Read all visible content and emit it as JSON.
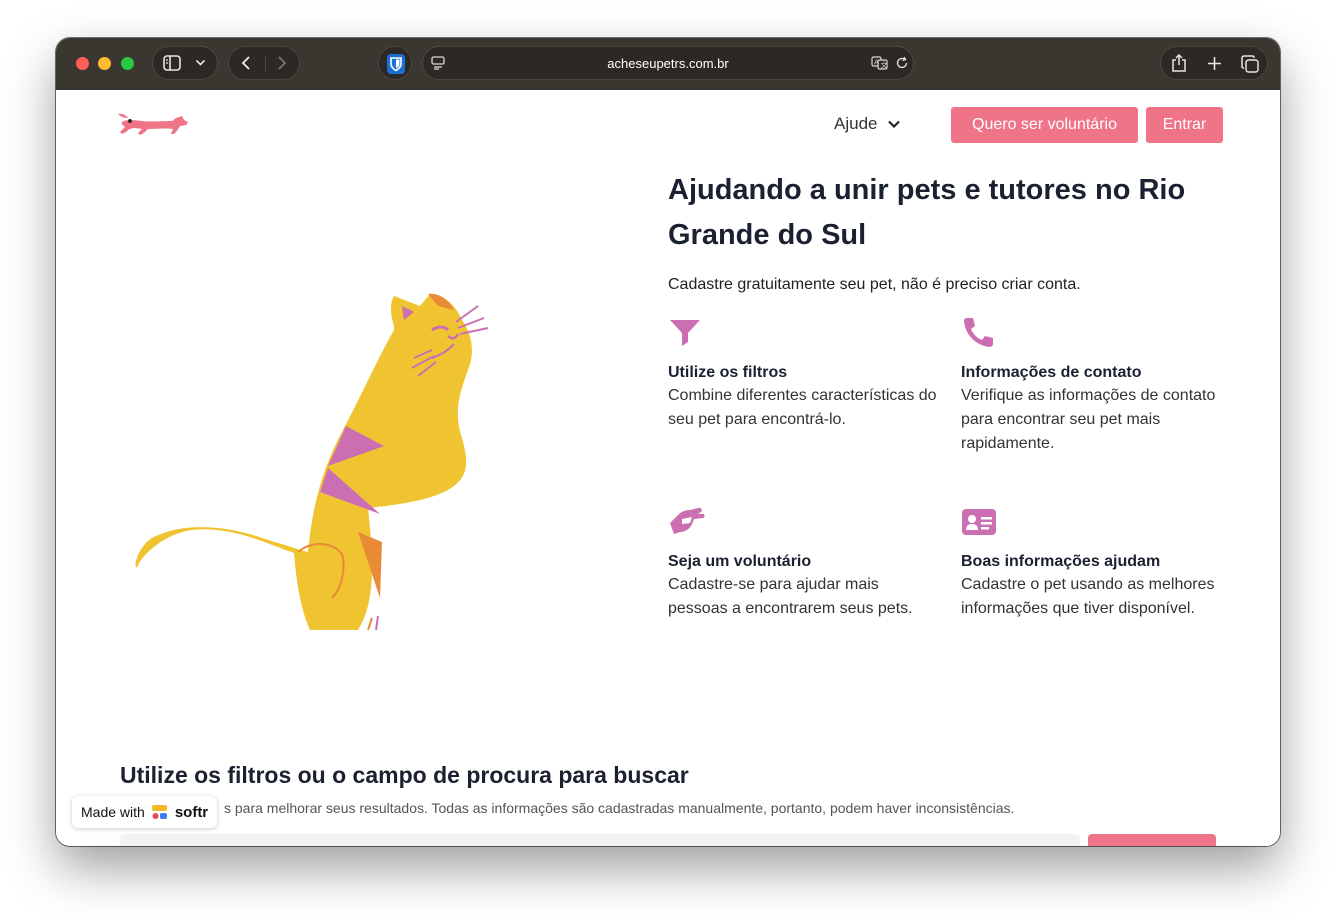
{
  "browser": {
    "url": "acheseupetrs.com.br"
  },
  "nav": {
    "help_label": "Ajude",
    "volunteer_label": "Quero ser voluntário",
    "login_label": "Entrar"
  },
  "hero": {
    "title": "Ajudando a unir pets e tutores no Rio Grande do Sul",
    "subtitle": "Cadastre gratuitamente seu pet, não é preciso criar conta."
  },
  "features": [
    {
      "icon": "filter-icon",
      "title": "Utilize os filtros",
      "text": "Combine diferentes características do seu pet para encontrá-lo."
    },
    {
      "icon": "phone-icon",
      "title": "Informações de contato",
      "text": "Verifique as informações de contato para encontrar seu pet mais rapidamente."
    },
    {
      "icon": "helping-hand-icon",
      "title": "Seja um voluntário",
      "text": "Cadastre-se para ajudar mais pessoas a encontrarem seus pets."
    },
    {
      "icon": "id-card-icon",
      "title": "Boas informações ajudam",
      "text": "Cadastre o pet usando as melhores informações que tiver disponível."
    }
  ],
  "search": {
    "title": "Utilize os filtros ou o campo de procura para buscar",
    "subtitle_visible": "s para melhorar seus resultados. Todas as informações são cadastradas manualmente, portanto, podem haver inconsistências."
  },
  "badge": {
    "made_with": "Made with",
    "brand": "softr"
  },
  "colors": {
    "accent_pink": "#f07488",
    "icon_magenta": "#cc6fb2",
    "cat_yellow": "#f0c431",
    "cat_orange": "#e88a36",
    "heading": "#1b2130",
    "titlebar": "#3a3630"
  }
}
